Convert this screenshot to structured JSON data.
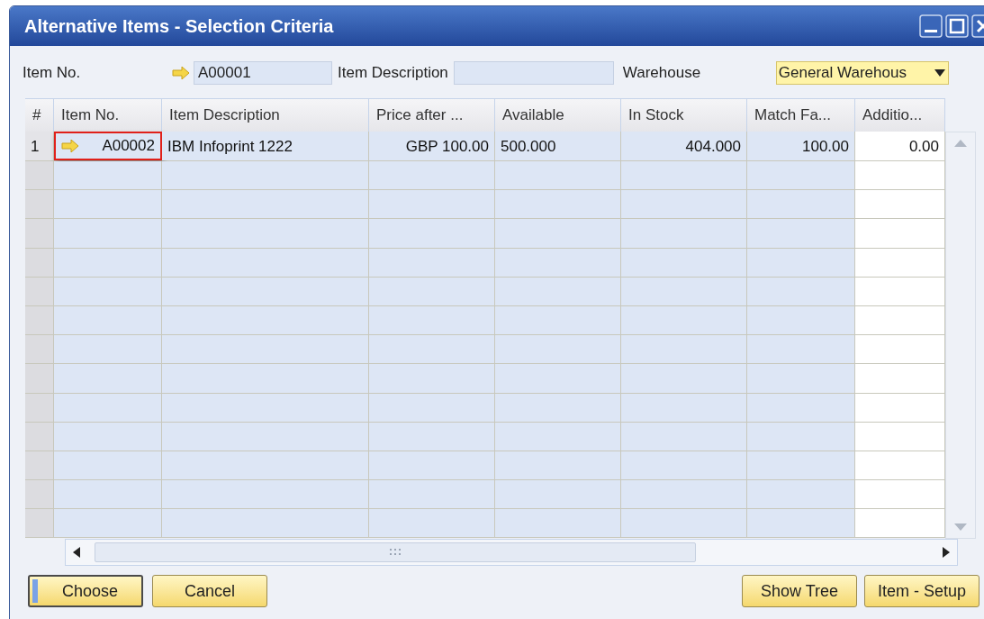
{
  "window": {
    "title": "Alternative Items - Selection Criteria"
  },
  "criteria": {
    "item_no_label": "Item No.",
    "item_no_value": "A00001",
    "item_description_label": "Item Description",
    "warehouse_label": "Warehouse",
    "warehouse_value": "General Warehous"
  },
  "table": {
    "columns": [
      "#",
      "Item No.",
      "Item Description",
      "Price after ...",
      "Available",
      "In Stock",
      "Match Fa...",
      "Additio..."
    ],
    "rows": [
      {
        "number": "1",
        "item_no": "A00002",
        "highlighted": true,
        "description": "IBM Infoprint 1222",
        "price": "GBP 100.00",
        "available": "500.000",
        "in_stock": "404.000",
        "match": "100.00",
        "additional": "0.00"
      }
    ]
  },
  "buttons": [
    {
      "label": "Choose",
      "default": true
    },
    {
      "label": "Cancel",
      "default": false
    },
    {
      "label": "Show Tree",
      "default": false
    },
    {
      "label": "Item - Setup",
      "default": false
    }
  ]
}
